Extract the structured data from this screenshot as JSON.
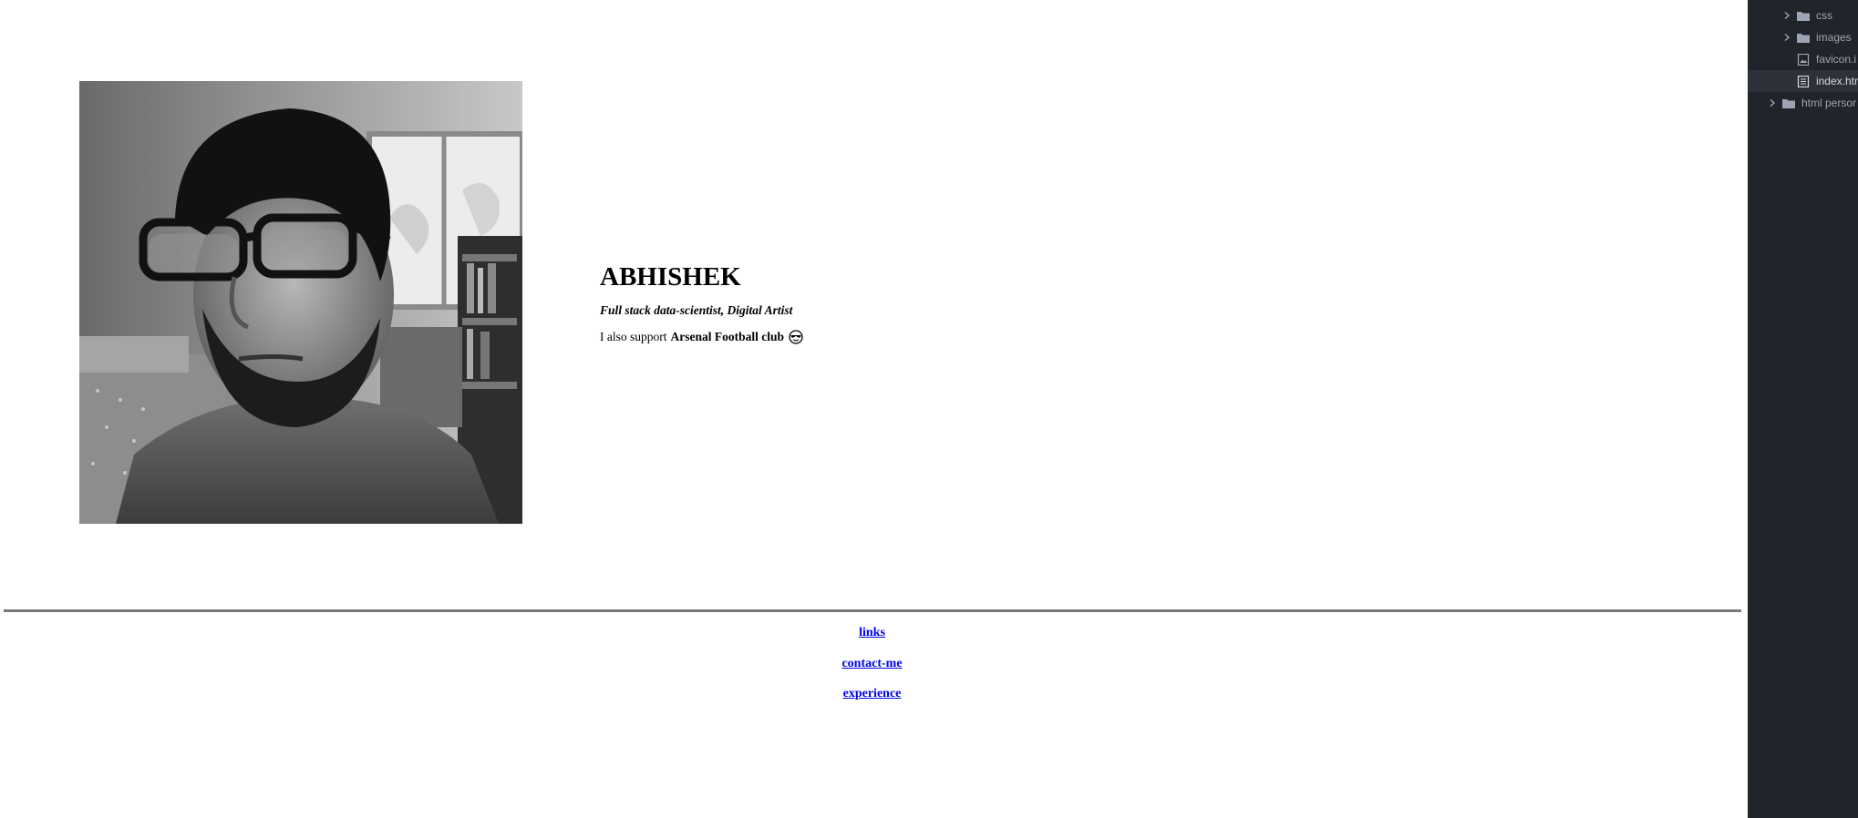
{
  "profile": {
    "name": "ABHISHEK",
    "tagline": "Full stack data-scientist, Digital Artist",
    "support_prefix": "I also support",
    "support_club": "Arsenal Football club",
    "emoji_icon": "smiling-face-with-sunglasses"
  },
  "footer_links": [
    {
      "label": "links"
    },
    {
      "label": "contact-me"
    },
    {
      "label": "experience"
    }
  ],
  "file_tree": {
    "items": [
      {
        "label": "css",
        "type": "folder",
        "icon": "folder-icon"
      },
      {
        "label": "images",
        "type": "folder",
        "icon": "folder-icon"
      },
      {
        "label": "favicon.i",
        "type": "file",
        "icon": "image-file-icon"
      },
      {
        "label": "index.htr",
        "type": "file",
        "icon": "file-icon",
        "selected": true
      },
      {
        "label": "html persor",
        "type": "folder",
        "icon": "folder-icon"
      }
    ]
  },
  "colors": {
    "link": "#0000ee",
    "sidebar_bg": "#21252b",
    "sidebar_selected": "#2c313a",
    "divider": "#7a7a7a"
  }
}
